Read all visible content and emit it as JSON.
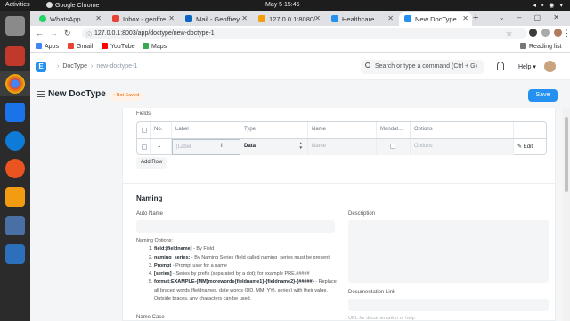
{
  "os": {
    "activities": "Activities",
    "app_name": "Google Chrome",
    "clock": "May 5  15:45"
  },
  "browser": {
    "tabs": [
      {
        "label": "WhatsApp",
        "color": "#25d366"
      },
      {
        "label": "Inbox - geoffre",
        "color": "#ea4335"
      },
      {
        "label": "Mail - Geoffrey",
        "color": "#0a66c2"
      },
      {
        "label": "127.0.0.1:8080/",
        "color": "#f59e0b"
      },
      {
        "label": "Healthcare",
        "color": "#2490ef"
      },
      {
        "label": "New DocType",
        "color": "#2490ef"
      }
    ],
    "url": "127.0.0.1:8003/app/doctype/new-doctype-1",
    "bookmarks": {
      "apps": "Apps",
      "gmail": "Gmail",
      "youtube": "YouTube",
      "maps": "Maps",
      "reading_list": "Reading list"
    }
  },
  "app": {
    "logo_letter": "E",
    "breadcrumb": [
      "DocType",
      "new-doctype-1"
    ],
    "search_placeholder": "Search or type a command (Ctrl + G)",
    "help_label": "Help",
    "page_title": "New DocType",
    "status": "Not Saved",
    "save_label": "Save"
  },
  "fields_section": {
    "label": "Fields",
    "columns": [
      "No.",
      "Label",
      "Type",
      "Name",
      "Mandat...",
      "Options"
    ],
    "rows": [
      {
        "no": "1",
        "label_placeholder": "Label",
        "type": "Data",
        "name_placeholder": "Name",
        "options_placeholder": "Options",
        "edit": "Edit"
      }
    ],
    "add_row": "Add Row"
  },
  "naming_section": {
    "title": "Naming",
    "auto_name_label": "Auto Name",
    "options_title": "Naming Options:",
    "options": [
      {
        "key": "field:[fieldname]",
        "text": " - By Field"
      },
      {
        "key": "naming_series:",
        "text": " - By Naming Series (field called naming_series must be present"
      },
      {
        "key": "Prompt",
        "text": " - Prompt user for a name"
      },
      {
        "key": "[series]",
        "text": " - Series by prefix (separated by a dot); for example PRE.#####"
      },
      {
        "key": "format:EXAMPLE-{MM}morewords{fieldname1}-{fieldname2}-{#####}",
        "text": " - Replace all braced words (fieldnames, date words (DD, MM, YY), series) with their value. Outside braces, any characters can be used."
      }
    ],
    "description_label": "Description",
    "doc_link_label": "Documentation Link",
    "doc_link_placeholder": "URL for documentation or help",
    "name_case_label": "Name Case"
  },
  "colors": {
    "primary": "#2490ef",
    "not_saved_bg": "#fff2e6",
    "not_saved_fg": "#e86c13"
  }
}
